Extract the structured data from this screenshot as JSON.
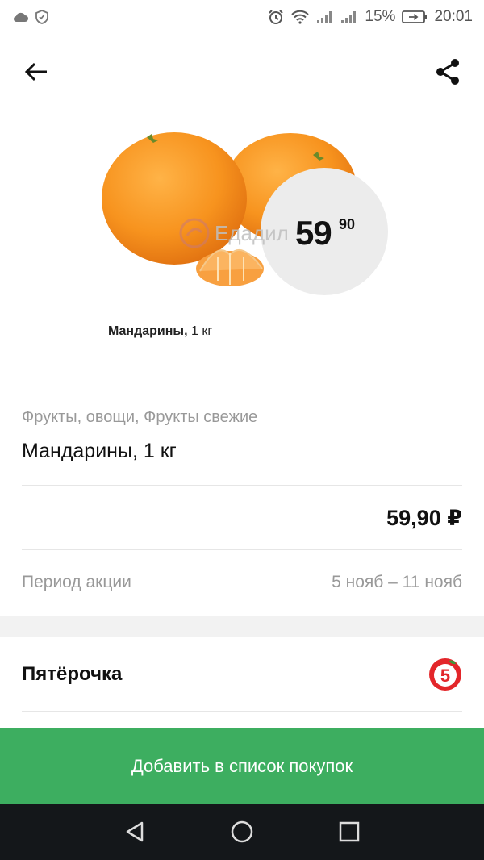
{
  "status_bar": {
    "battery": "15%",
    "time": "20:01"
  },
  "hero": {
    "watermark": "Едадил",
    "price_main": "59",
    "price_cents": "90",
    "caption_name": "Мандарины,",
    "caption_unit": "1 кг"
  },
  "product": {
    "category": "Фрукты, овощи, Фрукты свежие",
    "title": "Мандарины, 1 кг",
    "price": "59,90 ₽"
  },
  "period": {
    "label": "Период акции",
    "value": "5 нояб – 11 нояб"
  },
  "store": {
    "name": "Пятёрочка",
    "logo_text": "5"
  },
  "actions": {
    "add_to_list": "Добавить в список покупок"
  },
  "colors": {
    "accent_green": "#3dae60",
    "store_red": "#e3262a",
    "nav_bg": "#14171a"
  },
  "icons": [
    "cloud-icon",
    "shield-icon",
    "alarm-icon",
    "wifi-icon",
    "signal-icon",
    "battery-icon",
    "back-arrow-icon",
    "share-icon",
    "back-triangle-icon",
    "home-circle-icon",
    "recents-square-icon"
  ]
}
